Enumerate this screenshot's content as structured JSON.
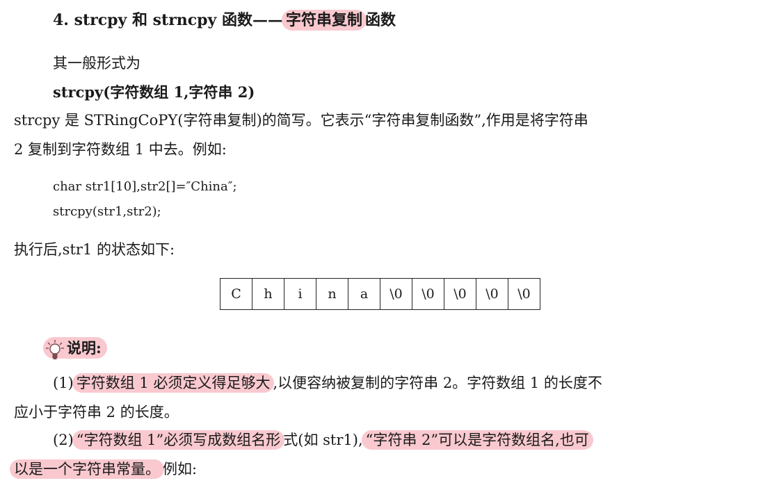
{
  "heading": {
    "prefix": "4. strcpy 和 strncpy 函数——",
    "highlight": "字符串复制",
    "suffix": "函数"
  },
  "general_form_label": "其一般形式为",
  "signature": "strcpy(字符数组 1,字符串 2)",
  "desc": {
    "line1": "strcpy 是 STRingCoPY(字符串复制)的简写。它表示“字符串复制函数”,作用是将字符串",
    "line2": "2 复制到字符数组 1 中去。例如:"
  },
  "code": {
    "line1": "char str1[10],str2[]=″China″;",
    "line2": "strcpy(str1,str2);"
  },
  "after_label": "执行后,str1 的状态如下:",
  "array_cells": [
    "C",
    "h",
    "i",
    "n",
    "a",
    "\\0",
    "\\0",
    "\\0",
    "\\0",
    "\\0"
  ],
  "note": {
    "title": "说明:",
    "p1_num": "(1)",
    "p1_hl": "字符数组 1 必须定义得足够大",
    "p1_rest": ",以便容纳被复制的字符串 2。字符数组 1 的长度不",
    "p1_line2": "应小于字符串 2 的长度。",
    "p2_num": "(2)",
    "p2_hl1": "“字符数组 1”必须写成数组名形",
    "p2_mid": "式(如 str1),",
    "p2_hl2": "“字符串 2”可以是字符数组名,也可",
    "p2_hl3": "以是一个字符串常量。",
    "p2_end": "例如:"
  },
  "colors": {
    "highlight": "#f9c9cf",
    "text": "#1a1a1a"
  }
}
